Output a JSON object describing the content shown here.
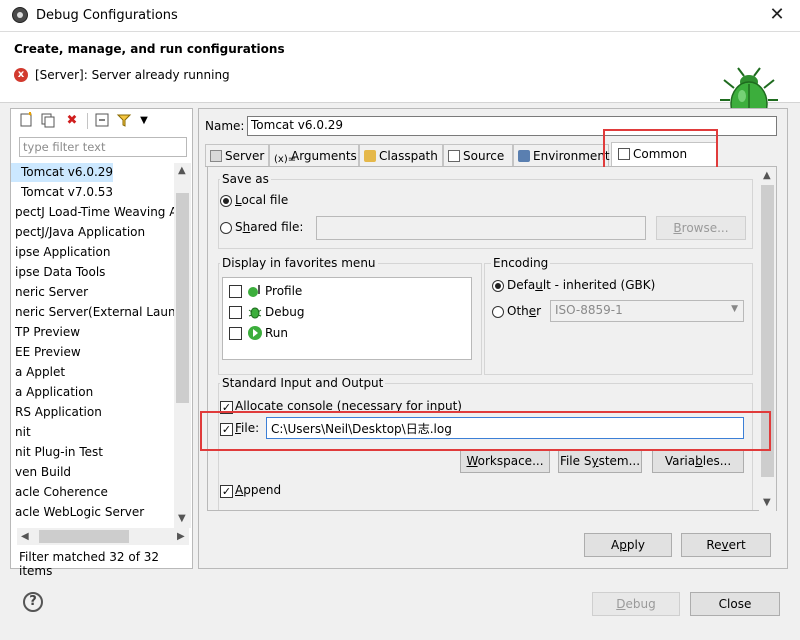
{
  "window": {
    "title": "Debug Configurations",
    "close_glyph": "✕"
  },
  "header": {
    "title": "Create, manage, and run configurations",
    "message": "[Server]: Server already running",
    "error_glyph": "x"
  },
  "left": {
    "filter_placeholder": "type filter text",
    "items": [
      "Tomcat v6.0.29",
      "Tomcat v7.0.53",
      "pectJ Load-Time Weaving A",
      "pectJ/Java Application",
      "ipse Application",
      "ipse Data Tools",
      "neric Server",
      "neric Server(External Launc",
      "TP Preview",
      "EE Preview",
      "a Applet",
      "a Application",
      "RS Application",
      "nit",
      "nit Plug-in Test",
      "ven Build",
      "acle Coherence",
      "acle WebLogic Server"
    ],
    "selected_index": 0,
    "status": "Filter matched 32 of 32 items"
  },
  "right": {
    "name_label": "Name:",
    "name_value": "Tomcat v6.0.29",
    "tabs": [
      "Server",
      "Arguments",
      "Classpath",
      "Source",
      "Environment",
      "Common"
    ],
    "active_tab": "Common",
    "save_as": {
      "title": "Save as",
      "local_file": "Local file",
      "shared_file": "Shared file:",
      "browse": "Browse..."
    },
    "favorites": {
      "title": "Display in favorites menu",
      "items": [
        "Profile",
        "Debug",
        "Run"
      ]
    },
    "encoding": {
      "title": "Encoding",
      "default": "Default - inherited (GBK)",
      "other": "Other",
      "other_value": "ISO-8859-1"
    },
    "std_io": {
      "title": "Standard Input and Output",
      "allocate": "Allocate console (necessary for input)",
      "file_label": "File:",
      "file_value": "C:\\Users\\Neil\\Desktop\\日志.log",
      "workspace": "Workspace...",
      "file_system": "File System...",
      "variables": "Variables...",
      "append": "Append"
    },
    "apply": "Apply",
    "revert": "Revert"
  },
  "footer": {
    "help_glyph": "?",
    "debug": "Debug",
    "close": "Close"
  },
  "colors": {
    "highlight_box": "#e03b3b",
    "selection": "#cce8ff",
    "bug_green": "#3cae3c"
  }
}
